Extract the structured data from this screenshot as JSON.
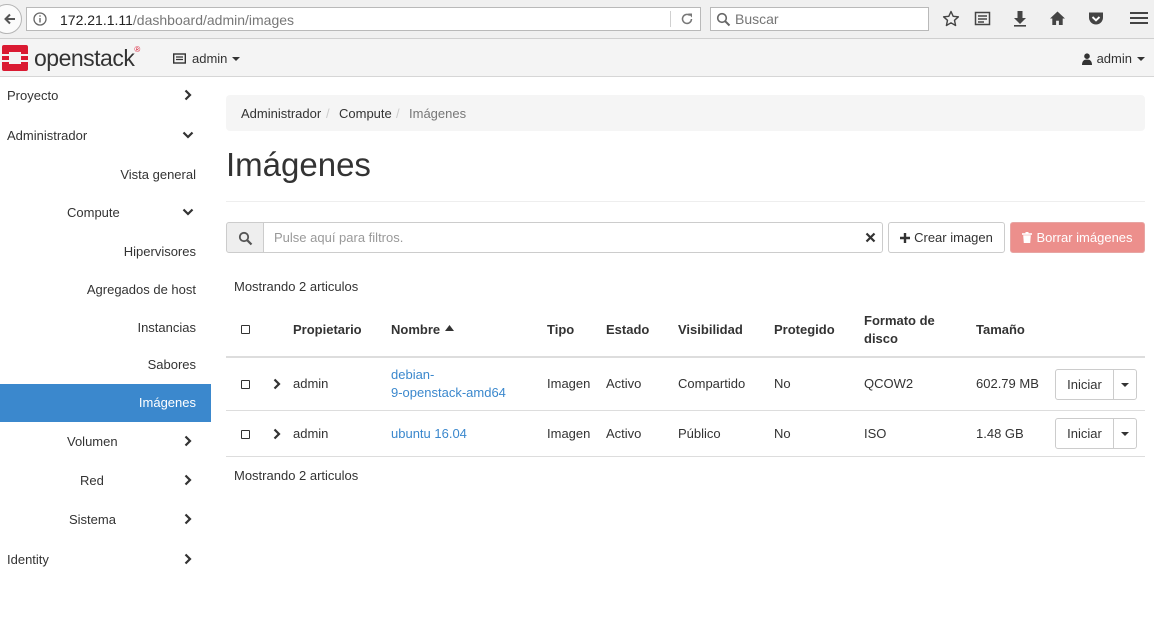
{
  "browser": {
    "url_host": "172.21.1.11",
    "url_path": "/dashboard/admin/images",
    "search_placeholder": "Buscar"
  },
  "header": {
    "logo_text": "openstack",
    "project": "admin",
    "user": "admin"
  },
  "sidebar": {
    "items": [
      {
        "label": "Proyecto",
        "chevron": "right"
      },
      {
        "label": "Administrador",
        "chevron": "down"
      },
      {
        "label": "Vista general"
      },
      {
        "label": "Compute",
        "chevron": "down"
      },
      {
        "label": "Hipervisores"
      },
      {
        "label": "Agregados de host"
      },
      {
        "label": "Instancias"
      },
      {
        "label": "Sabores"
      },
      {
        "label": "Imágenes",
        "active": true
      },
      {
        "label": "Volumen",
        "chevron": "right"
      },
      {
        "label": "Red",
        "chevron": "right"
      },
      {
        "label": "Sistema",
        "chevron": "right"
      },
      {
        "label": "Identity",
        "chevron": "right"
      }
    ]
  },
  "breadcrumb": {
    "items": [
      "Administrador",
      "Compute",
      "Imágenes"
    ],
    "separator": "/"
  },
  "page": {
    "title": "Imágenes"
  },
  "toolbar": {
    "filter_placeholder": "Pulse aquí para filtros.",
    "create_label": "Crear imagen",
    "delete_label": "Borrar imágenes"
  },
  "table": {
    "count_text": "Mostrando 2 articulos",
    "columns": [
      "Propietario",
      "Nombre",
      "Tipo",
      "Estado",
      "Visibilidad",
      "Protegido",
      "Formato de disco",
      "Tamaño"
    ],
    "rows": [
      {
        "owner": "admin",
        "name_line1": "debian-",
        "name_line2": "9-openstack-amd64",
        "type": "Imagen",
        "status": "Activo",
        "visibility": "Compartido",
        "protected": "No",
        "format": "QCOW2",
        "size": "602.79 MB",
        "action": "Iniciar"
      },
      {
        "owner": "admin",
        "name_line1": "ubuntu 16.04",
        "type": "Imagen",
        "status": "Activo",
        "visibility": "Público",
        "protected": "No",
        "format": "ISO",
        "size": "1.48 GB",
        "action": "Iniciar"
      }
    ]
  },
  "colors": {
    "accent": "#3b88cd",
    "danger_disabled": "#ec8f8c",
    "logo_red": "#da1a32"
  }
}
